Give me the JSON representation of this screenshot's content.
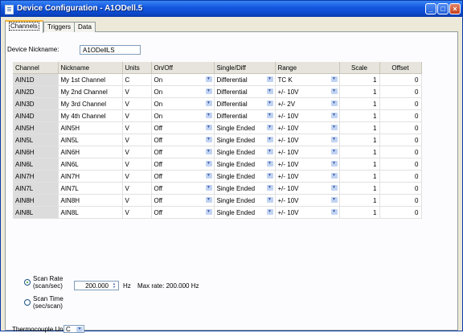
{
  "window": {
    "title": "Device Configuration - A1ODell.5",
    "controls": {
      "minimize": "_",
      "maximize": "□",
      "close": "×"
    }
  },
  "tabs": [
    {
      "label": "Channels",
      "active": true
    },
    {
      "label": "Triggers",
      "active": false
    },
    {
      "label": "Data",
      "active": false
    }
  ],
  "device": {
    "nickname_label": "Device Nickname:",
    "nickname_value": "A1ODellLS"
  },
  "table": {
    "headers": [
      "Channel",
      "Nickname",
      "Units",
      "On/Off",
      "Single/Diff",
      "Range",
      "Scale",
      "Offset"
    ],
    "rows": [
      {
        "channel": "AIN1D",
        "nickname": "My 1st Channel",
        "units": "C",
        "onoff": "On",
        "mode": "Differential",
        "range": "TC K",
        "scale": "1",
        "offset": "0"
      },
      {
        "channel": "AIN2D",
        "nickname": "My 2nd Channel",
        "units": "V",
        "onoff": "On",
        "mode": "Differential",
        "range": "+/- 10V",
        "scale": "1",
        "offset": "0"
      },
      {
        "channel": "AIN3D",
        "nickname": "My 3rd Channel",
        "units": "V",
        "onoff": "On",
        "mode": "Differential",
        "range": "+/- 2V",
        "scale": "1",
        "offset": "0"
      },
      {
        "channel": "AIN4D",
        "nickname": "My 4th Channel",
        "units": "V",
        "onoff": "On",
        "mode": "Differential",
        "range": "+/- 10V",
        "scale": "1",
        "offset": "0"
      },
      {
        "channel": "AIN5H",
        "nickname": "AIN5H",
        "units": "V",
        "onoff": "Off",
        "mode": "Single Ended",
        "range": "+/- 10V",
        "scale": "1",
        "offset": "0"
      },
      {
        "channel": "AIN5L",
        "nickname": "AIN5L",
        "units": "V",
        "onoff": "Off",
        "mode": "Single Ended",
        "range": "+/- 10V",
        "scale": "1",
        "offset": "0"
      },
      {
        "channel": "AIN6H",
        "nickname": "AIN6H",
        "units": "V",
        "onoff": "Off",
        "mode": "Single Ended",
        "range": "+/- 10V",
        "scale": "1",
        "offset": "0"
      },
      {
        "channel": "AIN6L",
        "nickname": "AIN6L",
        "units": "V",
        "onoff": "Off",
        "mode": "Single Ended",
        "range": "+/- 10V",
        "scale": "1",
        "offset": "0"
      },
      {
        "channel": "AIN7H",
        "nickname": "AIN7H",
        "units": "V",
        "onoff": "Off",
        "mode": "Single Ended",
        "range": "+/- 10V",
        "scale": "1",
        "offset": "0"
      },
      {
        "channel": "AIN7L",
        "nickname": "AIN7L",
        "units": "V",
        "onoff": "Off",
        "mode": "Single Ended",
        "range": "+/- 10V",
        "scale": "1",
        "offset": "0"
      },
      {
        "channel": "AIN8H",
        "nickname": "AIN8H",
        "units": "V",
        "onoff": "Off",
        "mode": "Single Ended",
        "range": "+/- 10V",
        "scale": "1",
        "offset": "0"
      },
      {
        "channel": "AIN8L",
        "nickname": "AIN8L",
        "units": "V",
        "onoff": "Off",
        "mode": "Single Ended",
        "range": "+/- 10V",
        "scale": "1",
        "offset": "0"
      }
    ]
  },
  "scan": {
    "rate_label_1": "Scan Rate",
    "rate_label_2": "(scan/sec)",
    "rate_value": "200.000",
    "rate_unit": "Hz",
    "max_rate": "Max rate: 200.000 Hz",
    "time_label_1": "Scan Time",
    "time_label_2": "(sec/scan)",
    "rate_selected": true
  },
  "thermocouple": {
    "label": "Thermocouple Units:",
    "value": "C"
  },
  "icons": {
    "dropdown": "▼",
    "spin_up": "▲",
    "spin_down": "▼"
  },
  "colors": {
    "titlebar": "#0b47c9",
    "window_bg": "#ece9d8",
    "tab_accent": "#f7b73a",
    "channel_cell": "#dcdcdc"
  }
}
